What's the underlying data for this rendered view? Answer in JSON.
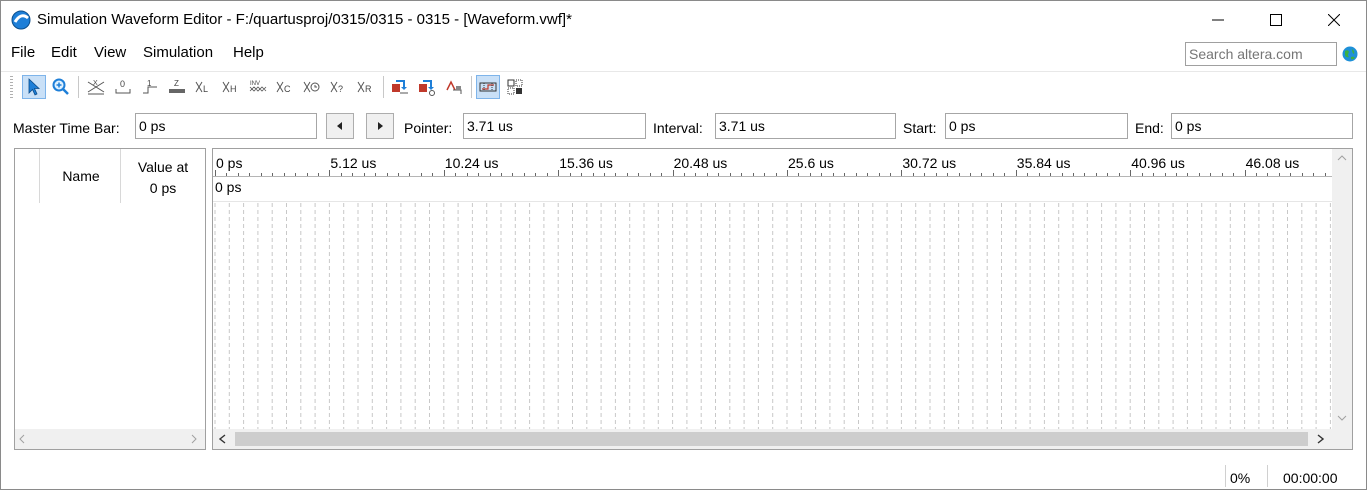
{
  "window": {
    "title": "Simulation Waveform Editor - F:/quartusproj/0315/0315 - 0315 - [Waveform.vwf]*"
  },
  "menu": {
    "items": [
      "File",
      "Edit",
      "View",
      "Simulation",
      "Help"
    ]
  },
  "search": {
    "placeholder": "Search altera.com"
  },
  "toolbar": {
    "tools": [
      "selection-tool",
      "zoom-tool",
      "force-unknown",
      "force-low",
      "force-high",
      "force-high-impedance",
      "force-weak-low",
      "force-weak-high",
      "invert",
      "count-value",
      "overwrite-clock",
      "random-values",
      "dont-care",
      "overwrite-value",
      "run-functional-simulation",
      "run-timing-simulation",
      "generate-netlist",
      "snap-to-grid",
      "grid-settings"
    ]
  },
  "timebar": {
    "master_label": "Master Time Bar:",
    "master_value": "0 ps",
    "pointer_label": "Pointer:",
    "pointer_value": "3.71 us",
    "interval_label": "Interval:",
    "interval_value": "3.71 us",
    "start_label": "Start:",
    "start_value": "0 ps",
    "end_label": "End:",
    "end_value": "0 ps"
  },
  "signal_table": {
    "name_header": "Name",
    "value_header_line1": "Value at",
    "value_header_line2": "0 ps"
  },
  "waveform": {
    "ruler_labels": [
      "0 ps",
      "5.12 us",
      "10.24 us",
      "15.36 us",
      "20.48 us",
      "25.6 us",
      "30.72 us",
      "35.84 us",
      "40.96 us",
      "46.08 us"
    ],
    "cursor_label": "0 ps"
  },
  "status": {
    "progress": "0%",
    "elapsed": "00:00:00"
  },
  "colors": {
    "accent": "#1e7fd8",
    "grid_line": "#c8c8c8",
    "active_tool_bg": "#c9e0f7"
  }
}
